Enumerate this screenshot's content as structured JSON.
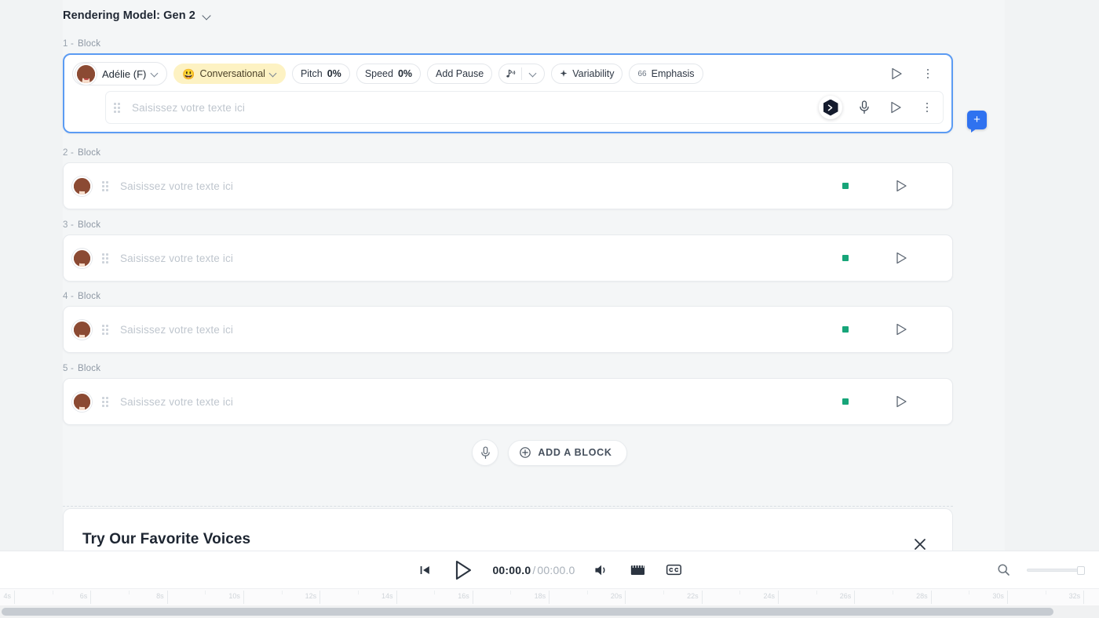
{
  "header": {
    "model_label": "Rendering Model: Gen 2",
    "dropdown_icon": "chevron-down-icon"
  },
  "blocks": [
    {
      "index": "1 -",
      "word": "Block",
      "active": true,
      "voice": "Adélie (F)",
      "style": "Conversational",
      "style_emoji": "😃",
      "pitch_label": "Pitch",
      "pitch_value": "0%",
      "speed_label": "Speed",
      "speed_value": "0%",
      "add_pause": "Add Pause",
      "variability": "Variability",
      "emphasis": "Emphasis",
      "emphasis_mark": "66",
      "placeholder": "Saisissez votre texte ici"
    },
    {
      "index": "2 -",
      "word": "Block",
      "active": false,
      "placeholder": "Saisissez votre texte ici"
    },
    {
      "index": "3 -",
      "word": "Block",
      "active": false,
      "placeholder": "Saisissez votre texte ici"
    },
    {
      "index": "4 -",
      "word": "Block",
      "active": false,
      "placeholder": "Saisissez votre texte ici"
    },
    {
      "index": "5 -",
      "word": "Block",
      "active": false,
      "placeholder": "Saisissez votre texte ici"
    }
  ],
  "add_row": {
    "mic_icon": "microphone-icon",
    "add_block_label": "ADD A BLOCK",
    "add_block_icon": "plus-circle-icon"
  },
  "favorites": {
    "title": "Try Our Favorite Voices",
    "close_icon": "close-icon"
  },
  "player": {
    "skip_start_icon": "skip-to-start-icon",
    "play_icon": "play-icon",
    "current_time": "00:00.0",
    "separator": "/",
    "total_time": "00:00.0",
    "volume_icon": "volume-icon",
    "clapper_icon": "film-clapper-icon",
    "captions_icon": "closed-captions-icon",
    "zoom_icon": "magnifier-icon"
  },
  "ruler": {
    "labels": [
      "4s",
      "6s",
      "8s",
      "10s",
      "12s",
      "14s",
      "16s",
      "18s",
      "20s",
      "22s",
      "24s",
      "26s",
      "28s",
      "30s",
      "32s"
    ]
  },
  "colors": {
    "accent_blue": "#2f72f0",
    "active_border": "#5b9bf3",
    "style_chip": "#fdf2c3",
    "status_green": "#17a579"
  }
}
